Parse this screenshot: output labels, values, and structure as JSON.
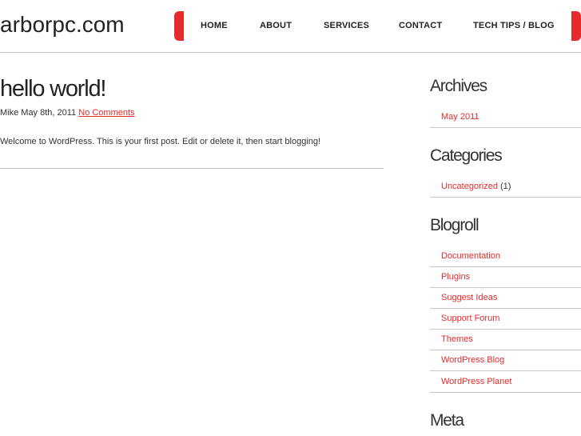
{
  "header": {
    "site_title": "arborpc.com",
    "nav": [
      {
        "label": "HOME"
      },
      {
        "label": "ABOUT"
      },
      {
        "label": "SERVICES"
      },
      {
        "label": "CONTACT"
      },
      {
        "label": "TECH TIPS / BLOG"
      }
    ]
  },
  "post": {
    "title": "hello world!",
    "meta_text": "Mike May 8th, 2011",
    "comments_link": "No Comments",
    "body": "Welcome to WordPress. This is your first post. Edit or delete it, then start blogging!"
  },
  "sidebar": {
    "archives": {
      "title": "Archives",
      "items": [
        {
          "label": "May 2011"
        }
      ]
    },
    "categories": {
      "title": "Categories",
      "items": [
        {
          "label": "Uncategorized",
          "count": "(1)"
        }
      ]
    },
    "blogroll": {
      "title": "Blogroll",
      "items": [
        {
          "label": "Documentation"
        },
        {
          "label": "Plugins"
        },
        {
          "label": "Suggest Ideas"
        },
        {
          "label": "Support Forum"
        },
        {
          "label": "Themes"
        },
        {
          "label": "WordPress Blog"
        },
        {
          "label": "WordPress Planet"
        }
      ]
    },
    "meta": {
      "title": "Meta"
    }
  },
  "colors": {
    "accent": "#e52b2b",
    "rule": "#c8c8c8",
    "text": "#333333"
  }
}
